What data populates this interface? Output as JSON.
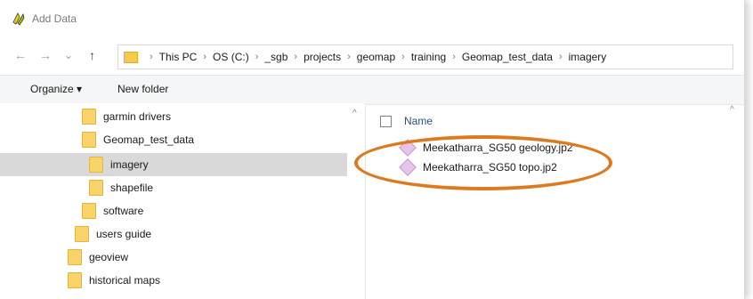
{
  "window": {
    "title": "Add Data",
    "app_icon": "app-logo-icon"
  },
  "nav": {
    "back_icon": "←",
    "forward_icon": "→",
    "recent_icon": "⌄",
    "up_icon": "↑",
    "breadcrumbs": [
      "This PC",
      "OS (C:)",
      "_sgb",
      "projects",
      "geomap",
      "training",
      "Geomap_test_data",
      "imagery"
    ]
  },
  "toolbar": {
    "organize_label": "Organize ▾",
    "new_folder_label": "New folder"
  },
  "sidebar": {
    "items": [
      {
        "label": "garmin drivers"
      },
      {
        "label": "Geomap_test_data"
      },
      {
        "label": "imagery"
      },
      {
        "label": "shapefile"
      },
      {
        "label": "software"
      },
      {
        "label": "users guide"
      },
      {
        "label": "geoview"
      },
      {
        "label": "historical maps"
      }
    ],
    "selected": "imagery"
  },
  "files": {
    "column_name": "Name",
    "items": [
      {
        "label": "Meekatharra_SG50 geology.jp2"
      },
      {
        "label": "Meekatharra_SG50 topo.jp2"
      }
    ]
  },
  "colors": {
    "highlight": "#dd7a1f",
    "folder": "#f8d36a",
    "selected_row": "#d9d9d9"
  }
}
